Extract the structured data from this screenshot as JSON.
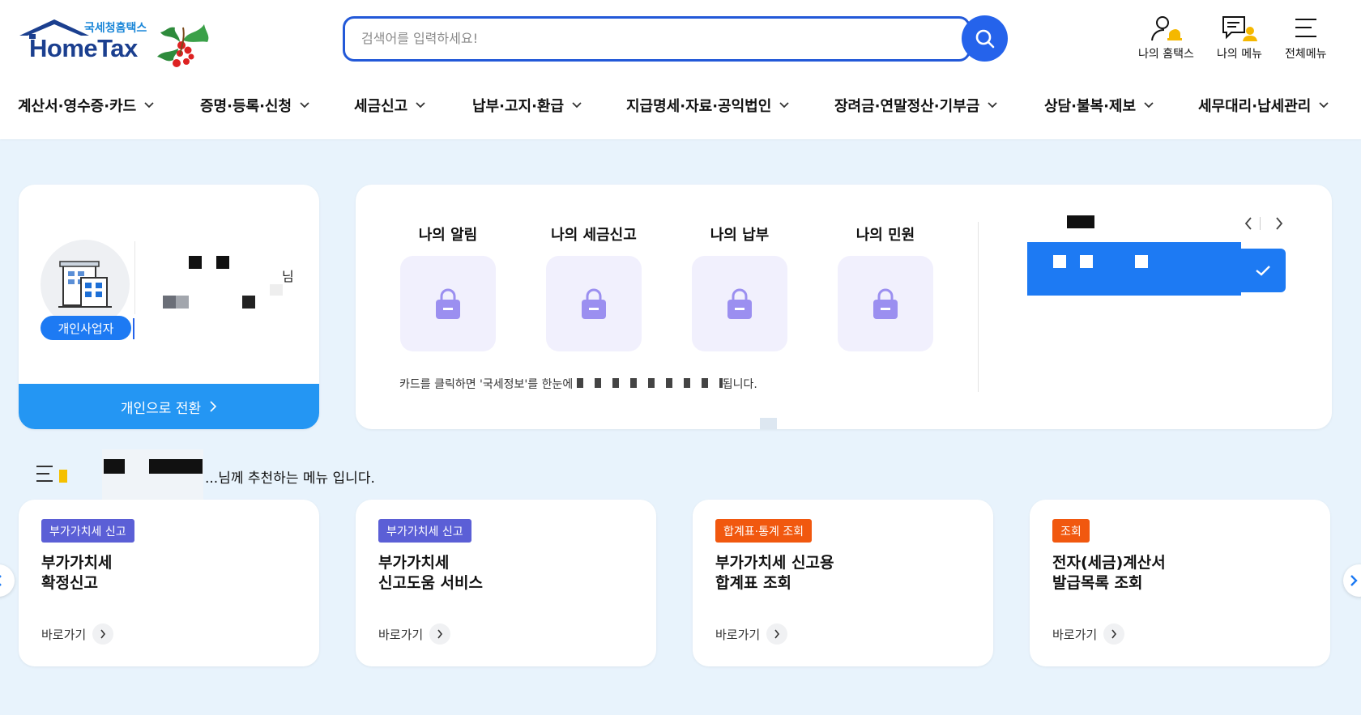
{
  "logo": {
    "brand": "HomeTax",
    "sub": "국세청홈택스"
  },
  "search": {
    "placeholder": "검색어를 입력하세요!"
  },
  "utils": [
    {
      "label": "나의 홈택스",
      "icon": "user-bell-icon"
    },
    {
      "label": "나의 메뉴",
      "icon": "chat-user-icon"
    },
    {
      "label": "전체메뉴",
      "icon": "hamburger-icon"
    }
  ],
  "gnb": [
    "계산서·영수증·카드",
    "증명·등록·신청",
    "세금신고",
    "납부·고지·환급",
    "지급명세·자료·공익법인",
    "장려금·연말정산·기부금",
    "상담·불복·제보",
    "세무대리·납세관리"
  ],
  "profile": {
    "user_type": "개인사업자",
    "suffix": "님",
    "switch_label": "개인으로 전환"
  },
  "my": {
    "items": [
      "나의 알림",
      "나의 세금신고",
      "나의 납부",
      "나의 민원"
    ],
    "note": "카드를 클릭하면 '국세정보'를 한눈에 ",
    "note_end": "됩니다."
  },
  "recommend": {
    "title_suffix": "...님께 추천하는 메뉴 입니다.",
    "go_label": "바로가기",
    "cards": [
      {
        "tag": "부가가치세 신고",
        "tag_color": "#5b5fd6",
        "name": "부가가치세\n확정신고"
      },
      {
        "tag": "부가가치세 신고",
        "tag_color": "#5b5fd6",
        "name": "부가가치세\n신고도움 서비스"
      },
      {
        "tag": "합계표·통계 조회",
        "tag_color": "#f1580f",
        "name": "부가가치세 신고용\n합계표 조회"
      },
      {
        "tag": "조회",
        "tag_color": "#f1580f",
        "name": "전자(세금)계산서\n발급목록 조회"
      }
    ]
  },
  "colors": {
    "primary": "#2563eb",
    "accent_blue": "#1d7af3",
    "background": "#e8f3fc",
    "brand_navy": "#1b3f8f"
  }
}
